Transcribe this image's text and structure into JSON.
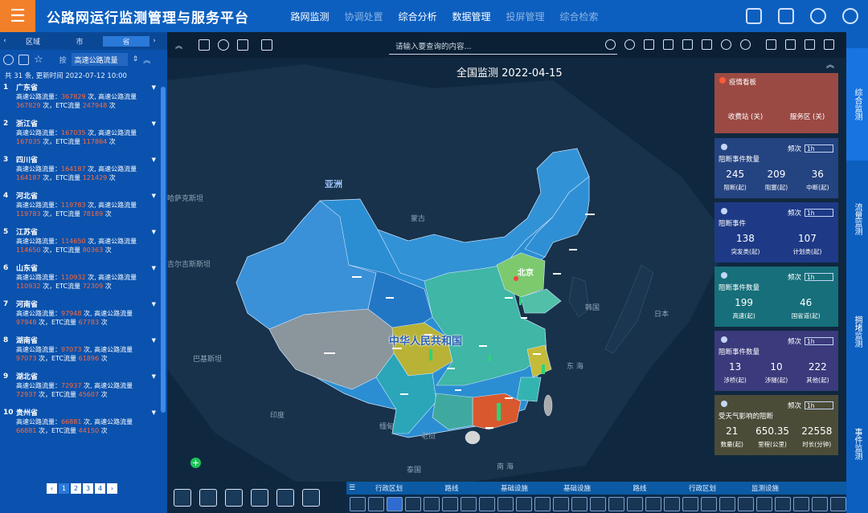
{
  "header": {
    "menu_icon": "hamburger-icon",
    "title": "公路网运行监测管理与服务平台",
    "nav": [
      {
        "label": "路网监测",
        "dim": false
      },
      {
        "label": "协调处置",
        "dim": true
      },
      {
        "label": "综合分析",
        "dim": false
      },
      {
        "label": "数据管理",
        "dim": false
      },
      {
        "label": "投屏管理",
        "dim": true
      },
      {
        "label": "综合检索",
        "dim": true
      }
    ]
  },
  "left": {
    "tabs": [
      "区域",
      "市",
      "省"
    ],
    "filter_label": "按",
    "filter_value": "高速公路流量",
    "summary": "共 31 条, 更新时间 2022-07-12 10:00",
    "provinces": [
      {
        "idx": "1",
        "name": "广东省",
        "a": "367829",
        "b": "367829",
        "c": "247948"
      },
      {
        "idx": "2",
        "name": "浙江省",
        "a": "167035",
        "b": "167035",
        "c": "117864"
      },
      {
        "idx": "3",
        "name": "四川省",
        "a": "164187",
        "b": "164187",
        "c": "121429"
      },
      {
        "idx": "4",
        "name": "河北省",
        "a": "119783",
        "b": "119783",
        "c": "78189"
      },
      {
        "idx": "5",
        "name": "江苏省",
        "a": "114650",
        "b": "114650",
        "c": "80363"
      },
      {
        "idx": "6",
        "name": "山东省",
        "a": "110932",
        "b": "110932",
        "c": "72309"
      },
      {
        "idx": "7",
        "name": "河南省",
        "a": "97948",
        "b": "97948",
        "c": "67783"
      },
      {
        "idx": "8",
        "name": "湖南省",
        "a": "97073",
        "b": "97073",
        "c": "61896"
      },
      {
        "idx": "9",
        "name": "湖北省",
        "a": "72937",
        "b": "72937",
        "c": "45607"
      },
      {
        "idx": "10",
        "name": "贵州省",
        "a": "66881",
        "b": "66881",
        "c": "44150"
      }
    ],
    "line_label1": "高速公路流量：",
    "line_unit1": " 次, 高速公路流量",
    "line_unit2": " 次，ETC流量 ",
    "line_unit3": " 次",
    "pages": [
      "1",
      "2",
      "3",
      "4"
    ]
  },
  "map": {
    "search_placeholder": "请输入要查询的内容...",
    "title": "全国监测 2022-04-15",
    "labels": {
      "asia": "亚洲",
      "mongolia": "蒙古",
      "kazakh": "哈萨克斯坦",
      "kyrgyz": "吉尔吉斯斯坦",
      "pakistan": "巴基斯坦",
      "india": "印度",
      "myanmar": "缅甸",
      "laos": "老挝",
      "thailand": "泰国",
      "korea": "韩国",
      "japan": "日本",
      "beijing": "北京",
      "china": "中华人民共和国",
      "eastsea": "东 海",
      "southsea": "南 海"
    }
  },
  "cards": [
    {
      "title": "疫情看板",
      "stats": [
        {
          "k": "收费站 (关)"
        },
        {
          "k": "服务区 (关)"
        }
      ]
    },
    {
      "title": "阻断事件数量",
      "freq": "频次",
      "freq_val": "1h",
      "stats": [
        {
          "v": "245",
          "k": "阻断(起)"
        },
        {
          "v": "209",
          "k": "阻塞(起)"
        },
        {
          "v": "36",
          "k": "中断(起)"
        }
      ]
    },
    {
      "title": "阻断事件",
      "freq": "频次",
      "freq_val": "1h",
      "stats": [
        {
          "v": "138",
          "k": "突发类(起)"
        },
        {
          "v": "107",
          "k": "计划类(起)"
        }
      ]
    },
    {
      "title": "阻断事件数量",
      "freq": "频次",
      "freq_val": "1h",
      "stats": [
        {
          "v": "199",
          "k": "高速(起)"
        },
        {
          "v": "46",
          "k": "国省道(起)"
        }
      ]
    },
    {
      "title": "阻断事件数量",
      "freq": "频次",
      "freq_val": "1h",
      "stats": [
        {
          "v": "13",
          "k": "涉桥(起)"
        },
        {
          "v": "10",
          "k": "涉隧(起)"
        },
        {
          "v": "222",
          "k": "其他(起)"
        }
      ]
    },
    {
      "title": "受天气影响的阻断",
      "freq": "频次",
      "freq_val": "1h",
      "stats": [
        {
          "v": "21",
          "k": "数量(起)"
        },
        {
          "v": "650.35",
          "k": "里程(公里)"
        },
        {
          "v": "22558",
          "k": "时长(分钟)"
        }
      ]
    }
  ],
  "vtabs": [
    "综合监测",
    "流量监测",
    "拥堵监测",
    "事件监测"
  ],
  "bottom_tabs": [
    "行政区划",
    "路线",
    "基础设施",
    "基础设施",
    "路线",
    "行政区划",
    "监测设施"
  ],
  "colors": {
    "topbar": "#0c5fbf",
    "left": "#0a52ad",
    "logo": "#f2802a",
    "accent": "#ff6a3a"
  }
}
